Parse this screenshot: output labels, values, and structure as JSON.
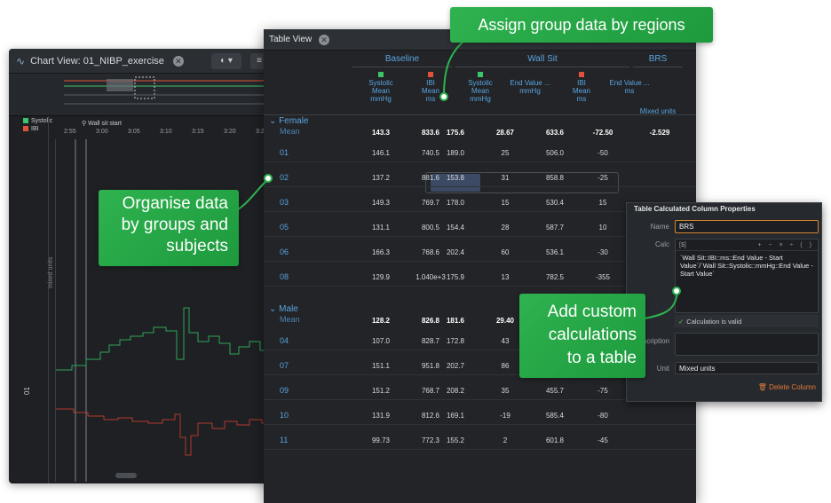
{
  "chart_view": {
    "title": "Chart View: 01_NIBP_exercise",
    "marker_label": "Wall sit start",
    "time_ticks": [
      "2:55",
      "3:00",
      "3:05",
      "3:10",
      "3:15",
      "3:20",
      "3:25"
    ],
    "legend": [
      {
        "name": "Systolic",
        "color": "#3cc46a"
      },
      {
        "name": "IBI",
        "color": "#e0533a"
      }
    ],
    "yaxis_label": "mixed units",
    "row_label": "01"
  },
  "table_view": {
    "title": "Table View",
    "groups": [
      "Baseline",
      "Wall Sit",
      "BRS"
    ],
    "columns": [
      {
        "channel": "Systolic",
        "stat": "Mean",
        "unit": "mmHg",
        "color": "#3cc46a"
      },
      {
        "channel": "IBI",
        "stat": "Mean",
        "unit": "ms",
        "color": "#e0533a"
      },
      {
        "channel": "Systolic",
        "stat": "Mean",
        "unit": "mmHg",
        "color": "#3cc46a"
      },
      {
        "channel": "",
        "stat": "End Value ...",
        "unit": "mmHg",
        "color": ""
      },
      {
        "channel": "IBI",
        "stat": "Mean",
        "unit": "ms",
        "color": "#e0533a"
      },
      {
        "channel": "",
        "stat": "End Value ...",
        "unit": "ms",
        "color": ""
      },
      {
        "channel": "",
        "stat": "Mixed units",
        "unit": "",
        "color": ""
      }
    ],
    "sections": [
      {
        "name": "Female",
        "mean_label": "Mean",
        "mean": [
          "143.3",
          "833.6",
          "175.6",
          "28.67",
          "633.6",
          "-72.50",
          "-2.529"
        ],
        "rows": [
          {
            "id": "01",
            "values": [
              "146.1",
              "740.5",
              "189.0",
              "25",
              "506.0",
              "-50",
              ""
            ]
          },
          {
            "id": "02",
            "values": [
              "137.2",
              "881.6",
              "153.8",
              "31",
              "858.8",
              "-25",
              ""
            ]
          },
          {
            "id": "03",
            "values": [
              "149.3",
              "769.7",
              "178.0",
              "15",
              "530.4",
              "15",
              ""
            ]
          },
          {
            "id": "05",
            "values": [
              "131.1",
              "800.5",
              "154.4",
              "28",
              "587.7",
              "10",
              ""
            ]
          },
          {
            "id": "06",
            "values": [
              "166.3",
              "768.6",
              "202.4",
              "60",
              "536.1",
              "-30",
              ""
            ]
          },
          {
            "id": "08",
            "values": [
              "129.9",
              "1.040e+3",
              "175.9",
              "13",
              "782.5",
              "-355",
              ""
            ]
          }
        ]
      },
      {
        "name": "Male",
        "mean_label": "Mean",
        "mean": [
          "128.2",
          "826.8",
          "181.6",
          "29.40",
          "",
          "",
          ""
        ],
        "rows": [
          {
            "id": "04",
            "values": [
              "107.0",
              "828.7",
              "172.8",
              "43",
              "",
              "",
              ""
            ]
          },
          {
            "id": "07",
            "values": [
              "151.1",
              "951.8",
              "202.7",
              "86",
              "",
              "",
              ""
            ]
          },
          {
            "id": "09",
            "values": [
              "151.2",
              "768.7",
              "208.2",
              "35",
              "455.7",
              "-75",
              ""
            ]
          },
          {
            "id": "10",
            "values": [
              "131.9",
              "812.6",
              "169.1",
              "-19",
              "585.4",
              "-80",
              ""
            ]
          },
          {
            "id": "11",
            "values": [
              "99.73",
              "772.3",
              "155.2",
              "2",
              "601.8",
              "-45",
              ""
            ]
          }
        ]
      }
    ]
  },
  "properties": {
    "title": "Table Calculated Column Properties",
    "name_label": "Name",
    "name_value": "BRS",
    "calc_label": "Calc",
    "calc_toolbar_left": "[$]",
    "calc_toolbar_ops": "+ − × ÷ ( )",
    "calc_text": "`Wall Sit::IBI::ms::End Value - Start Value`/`Wall Sit::Systolic::mmHg::End Value - Start Value`",
    "valid_text": "Calculation is valid",
    "desc_label": "Description",
    "unit_label": "Unit",
    "unit_value": "Mixed units",
    "delete_label": "Delete Column"
  },
  "callouts": {
    "assign": "Assign group data by regions",
    "organise_lines": [
      "Organise data",
      "by groups and",
      "subjects"
    ],
    "calc_lines": [
      "Add custom",
      "calculations",
      "to a table"
    ]
  }
}
